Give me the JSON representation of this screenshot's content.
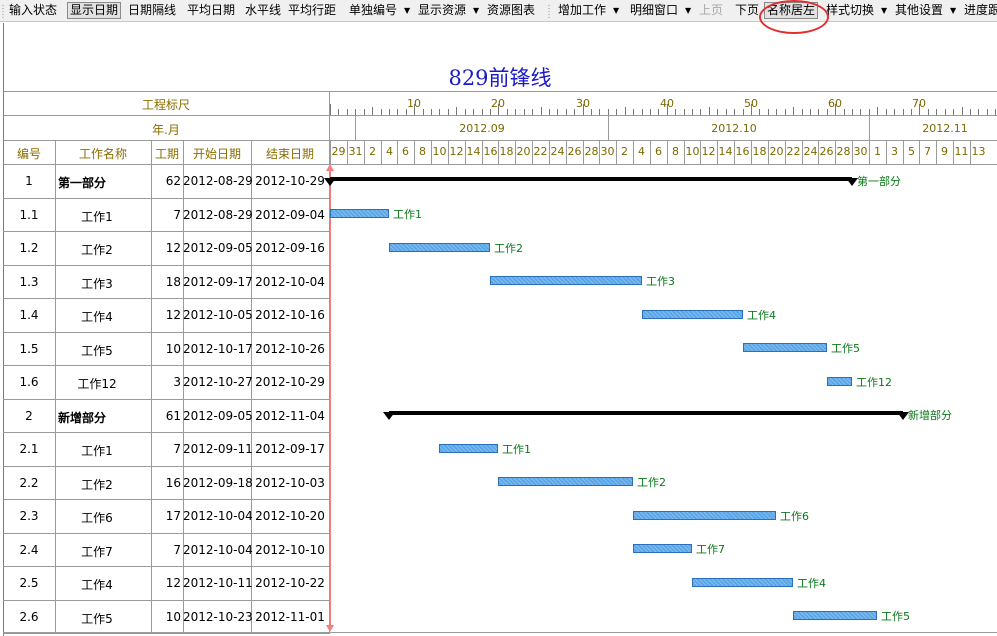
{
  "toolbar": {
    "items": [
      {
        "label": "输入状态",
        "state": "normal"
      },
      {
        "label": "显示日期",
        "state": "pressed"
      },
      {
        "label": "日期隔线",
        "state": "normal"
      },
      {
        "label": "平均日期",
        "state": "normal"
      },
      {
        "label": "水平线",
        "state": "normal"
      },
      {
        "label": "平均行距",
        "state": "normal"
      },
      {
        "label": "单独编号",
        "state": "dropdown"
      },
      {
        "label": "显示资源",
        "state": "dropdown"
      },
      {
        "label": "资源图表",
        "state": "normal"
      },
      {
        "label": "增加工作",
        "state": "dropdown"
      },
      {
        "label": "明细窗口",
        "state": "dropdown"
      },
      {
        "label": "上页",
        "state": "disabled"
      },
      {
        "label": "下页",
        "state": "normal"
      },
      {
        "label": "名称居左",
        "state": "pressed"
      },
      {
        "label": "样式切换",
        "state": "dropdown"
      },
      {
        "label": "其他设置",
        "state": "dropdown"
      },
      {
        "label": "进度跟",
        "state": "normal"
      }
    ]
  },
  "title": "829前锋线",
  "colors": {
    "title": "#1a1acc",
    "header_text": "#8a6d00",
    "bar_fill": "#5aa6e8",
    "bar_border": "#2a70b8",
    "label": "#0a7a1a",
    "today_line": "#f08080",
    "annotation": "#e03030"
  },
  "header": {
    "ruler_label": "工程标尺",
    "period_label": "年.月",
    "columns": {
      "id": "编号",
      "name": "工作名称",
      "duration": "工期",
      "start": "开始日期",
      "end": "结束日期"
    },
    "ruler_numbers": [
      "10",
      "20",
      "30",
      "40",
      "50",
      "60",
      "70"
    ],
    "months": [
      "2012.09",
      "2012.10",
      "2012.11"
    ],
    "days": [
      "29",
      "31",
      "2",
      "4",
      "6",
      "8",
      "10",
      "12",
      "14",
      "16",
      "18",
      "20",
      "22",
      "24",
      "26",
      "28",
      "30",
      "2",
      "4",
      "6",
      "8",
      "10",
      "12",
      "14",
      "16",
      "18",
      "20",
      "22",
      "24",
      "26",
      "28",
      "30",
      "1",
      "3",
      "5",
      "7",
      "9",
      "11",
      "13"
    ]
  },
  "tasks": [
    {
      "id": "1",
      "name": "第一部分",
      "duration": "62",
      "start": "2012-08-29",
      "end": "2012-10-29",
      "summary": true
    },
    {
      "id": "1.1",
      "name": "工作1",
      "duration": "7",
      "start": "2012-08-29",
      "end": "2012-09-04",
      "summary": false
    },
    {
      "id": "1.2",
      "name": "工作2",
      "duration": "12",
      "start": "2012-09-05",
      "end": "2012-09-16",
      "summary": false
    },
    {
      "id": "1.3",
      "name": "工作3",
      "duration": "18",
      "start": "2012-09-17",
      "end": "2012-10-04",
      "summary": false
    },
    {
      "id": "1.4",
      "name": "工作4",
      "duration": "12",
      "start": "2012-10-05",
      "end": "2012-10-16",
      "summary": false
    },
    {
      "id": "1.5",
      "name": "工作5",
      "duration": "10",
      "start": "2012-10-17",
      "end": "2012-10-26",
      "summary": false
    },
    {
      "id": "1.6",
      "name": "工作12",
      "duration": "3",
      "start": "2012-10-27",
      "end": "2012-10-29",
      "summary": false
    },
    {
      "id": "2",
      "name": "新增部分",
      "duration": "61",
      "start": "2012-09-05",
      "end": "2012-11-04",
      "summary": true
    },
    {
      "id": "2.1",
      "name": "工作1",
      "duration": "7",
      "start": "2012-09-11",
      "end": "2012-09-17",
      "summary": false
    },
    {
      "id": "2.2",
      "name": "工作2",
      "duration": "16",
      "start": "2012-09-18",
      "end": "2012-10-03",
      "summary": false
    },
    {
      "id": "2.3",
      "name": "工作6",
      "duration": "17",
      "start": "2012-10-04",
      "end": "2012-10-20",
      "summary": false
    },
    {
      "id": "2.4",
      "name": "工作7",
      "duration": "7",
      "start": "2012-10-04",
      "end": "2012-10-10",
      "summary": false
    },
    {
      "id": "2.5",
      "name": "工作4",
      "duration": "12",
      "start": "2012-10-11",
      "end": "2012-10-22",
      "summary": false
    },
    {
      "id": "2.6",
      "name": "工作5",
      "duration": "10",
      "start": "2012-10-23",
      "end": "2012-11-01",
      "summary": false
    }
  ]
}
